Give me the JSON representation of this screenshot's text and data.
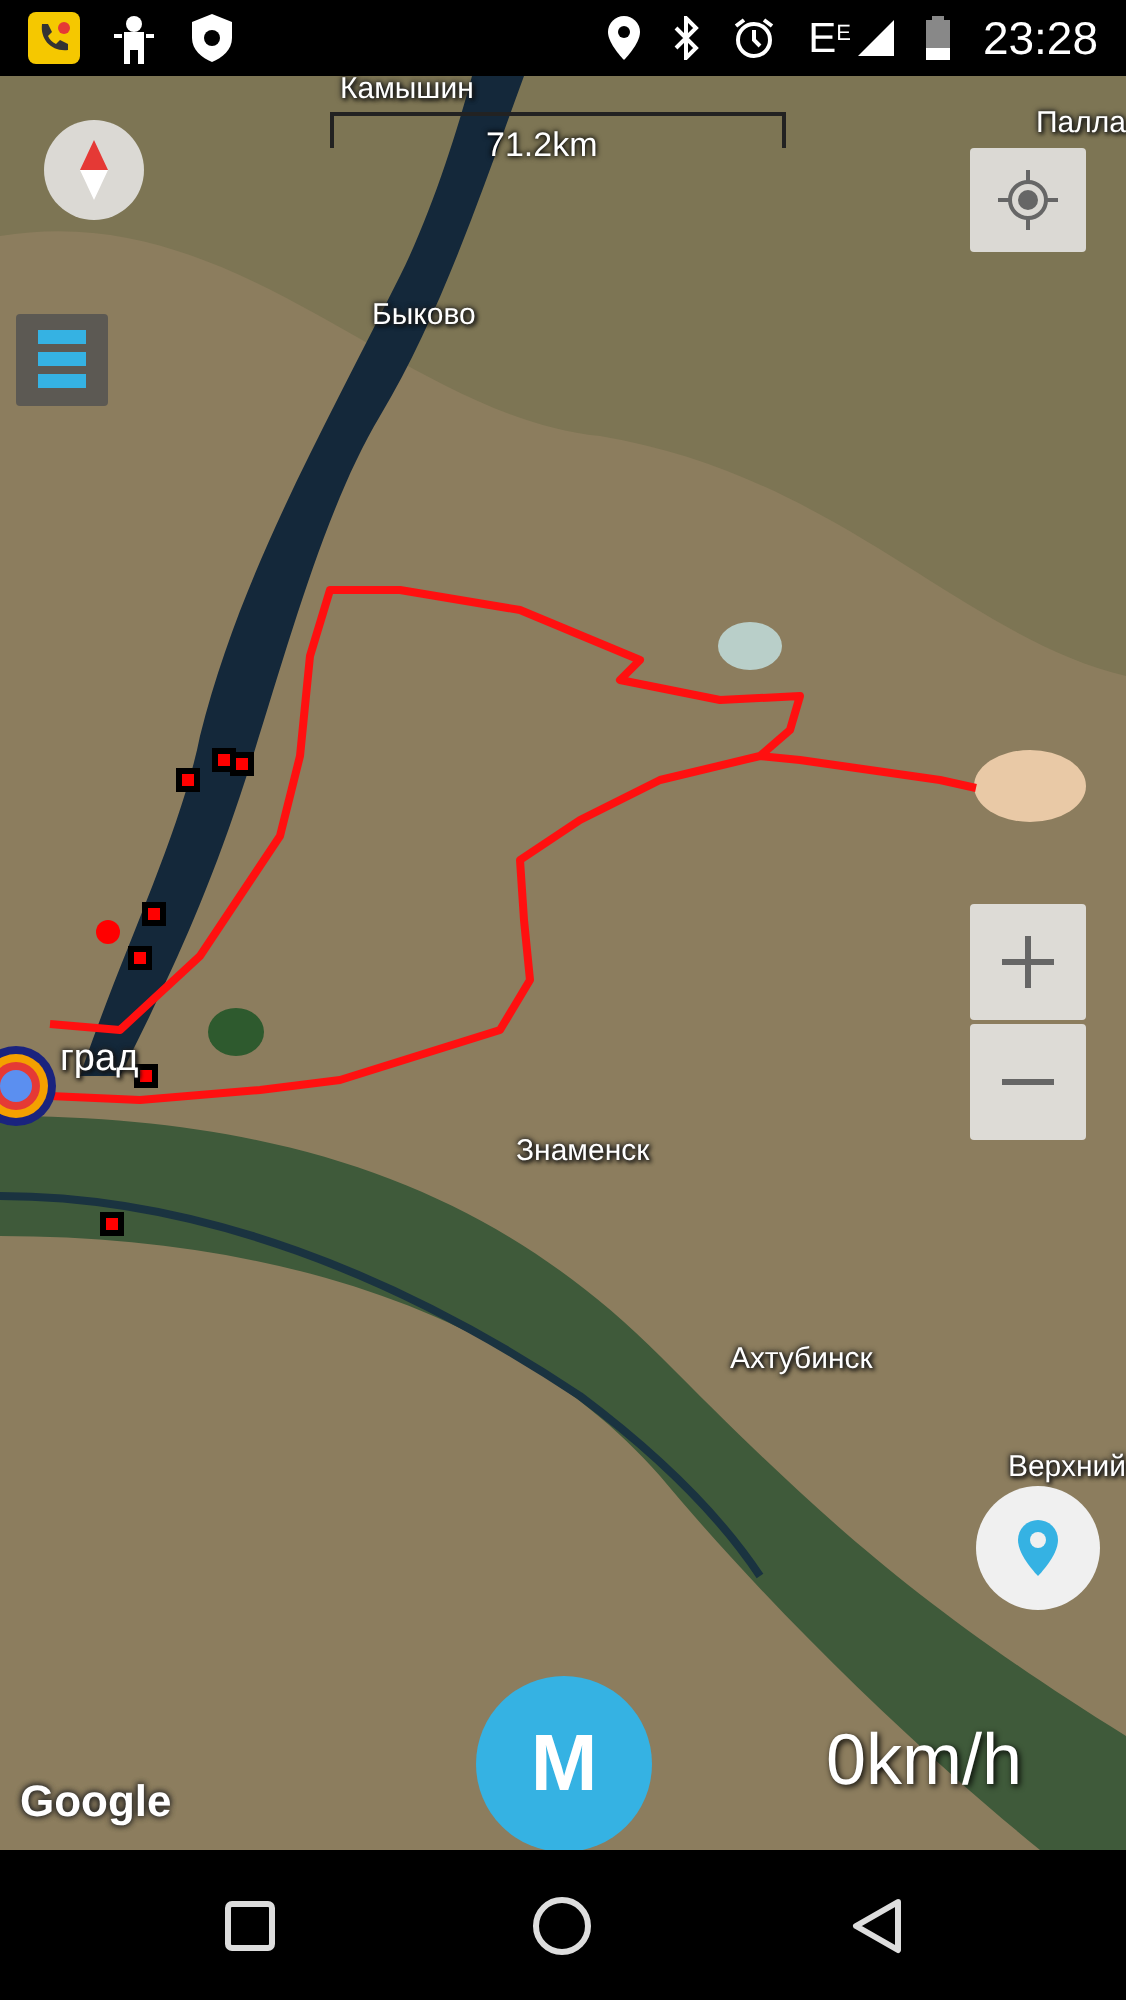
{
  "status_bar": {
    "network": "E$^{E}$",
    "time": "23:28"
  },
  "map": {
    "scale": "71.2km",
    "labels": [
      {
        "text": "Камышин"
      },
      {
        "text": "Палла"
      },
      {
        "text": "Быково"
      },
      {
        "text": "град"
      },
      {
        "text": "Знаменск"
      },
      {
        "text": "Ахтубинск"
      },
      {
        "text": "Верхний"
      }
    ],
    "attribution": "Google",
    "speed": "0km/h",
    "menu_button": "M"
  }
}
